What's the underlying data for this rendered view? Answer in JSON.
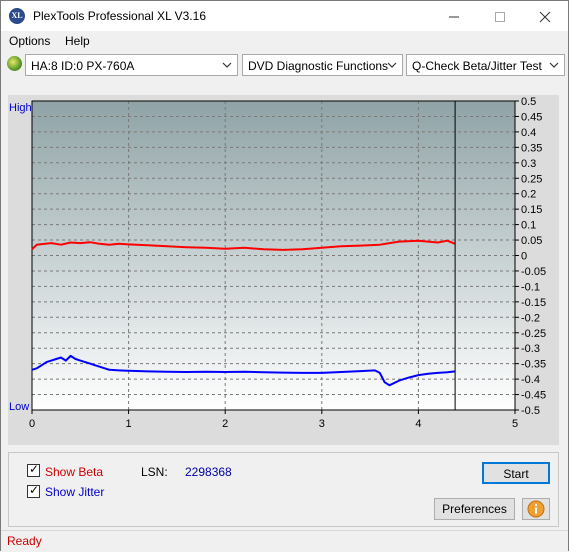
{
  "window": {
    "title": "PlexTools Professional XL V3.16",
    "icon_text": "XL",
    "controls": [
      "minimize-icon",
      "maximize-icon",
      "close-icon"
    ]
  },
  "menu": {
    "options": "Options",
    "help": "Help"
  },
  "toolbar": {
    "drive": "HA:8 ID:0  PX-760A",
    "function": "DVD Diagnostic Functions",
    "test": "Q-Check Beta/Jitter Test"
  },
  "chart_labels": {
    "high": "High",
    "low": "Low"
  },
  "chart_data": {
    "type": "line",
    "x_ticks": [
      "0",
      "1",
      "2",
      "3",
      "4",
      "5"
    ],
    "xlim": [
      0,
      5
    ],
    "y_right_ticks": [
      "0.5",
      "0.45",
      "0.4",
      "0.35",
      "0.3",
      "0.25",
      "0.2",
      "0.15",
      "0.1",
      "0.05",
      "0",
      "-0.05",
      "-0.1",
      "-0.15",
      "-0.2",
      "-0.25",
      "-0.3",
      "-0.35",
      "-0.4",
      "-0.45",
      "-0.5"
    ],
    "ylim": [
      -0.5,
      0.5
    ],
    "grid": true,
    "end_marker_x": 4.38,
    "series": [
      {
        "name": "Beta",
        "color": "#ff0000",
        "x": [
          0,
          0.05,
          0.1,
          0.2,
          0.3,
          0.4,
          0.5,
          0.6,
          0.7,
          0.8,
          0.9,
          1.0,
          1.2,
          1.4,
          1.6,
          1.8,
          2.0,
          2.2,
          2.4,
          2.6,
          2.8,
          3.0,
          3.2,
          3.4,
          3.6,
          3.8,
          4.0,
          4.1,
          4.2,
          4.3,
          4.38
        ],
        "y": [
          0.02,
          0.035,
          0.037,
          0.04,
          0.035,
          0.042,
          0.04,
          0.043,
          0.038,
          0.035,
          0.038,
          0.036,
          0.033,
          0.03,
          0.027,
          0.025,
          0.022,
          0.025,
          0.02,
          0.018,
          0.02,
          0.025,
          0.03,
          0.032,
          0.035,
          0.045,
          0.048,
          0.045,
          0.042,
          0.048,
          0.038
        ]
      },
      {
        "name": "Jitter",
        "color": "#0000ff",
        "x": [
          0,
          0.05,
          0.1,
          0.15,
          0.2,
          0.25,
          0.3,
          0.35,
          0.4,
          0.45,
          0.5,
          0.55,
          0.6,
          0.65,
          0.7,
          0.8,
          0.9,
          1.0,
          1.2,
          1.4,
          1.6,
          1.8,
          2.0,
          2.2,
          2.4,
          2.6,
          2.8,
          3.0,
          3.2,
          3.4,
          3.55,
          3.6,
          3.65,
          3.7,
          3.8,
          3.9,
          4.0,
          4.1,
          4.2,
          4.3,
          4.38
        ],
        "y": [
          -0.37,
          -0.365,
          -0.355,
          -0.345,
          -0.34,
          -0.335,
          -0.33,
          -0.34,
          -0.325,
          -0.335,
          -0.34,
          -0.345,
          -0.35,
          -0.355,
          -0.36,
          -0.37,
          -0.372,
          -0.373,
          -0.375,
          -0.376,
          -0.377,
          -0.376,
          -0.377,
          -0.376,
          -0.378,
          -0.379,
          -0.38,
          -0.38,
          -0.377,
          -0.374,
          -0.372,
          -0.38,
          -0.41,
          -0.42,
          -0.405,
          -0.395,
          -0.387,
          -0.383,
          -0.38,
          -0.378,
          -0.375
        ]
      }
    ]
  },
  "bottom": {
    "show_beta": "Show Beta",
    "show_jitter": "Show Jitter",
    "lsn_label": "LSN:",
    "lsn_value": "2298368",
    "start": "Start",
    "preferences": "Preferences"
  },
  "status": {
    "text": "Ready"
  },
  "colors": {
    "beta_label": "#cc0000",
    "jitter_label": "#0000cc",
    "plot_bg_top": "#8fa3a6",
    "plot_bg_bottom": "#ffffff"
  }
}
